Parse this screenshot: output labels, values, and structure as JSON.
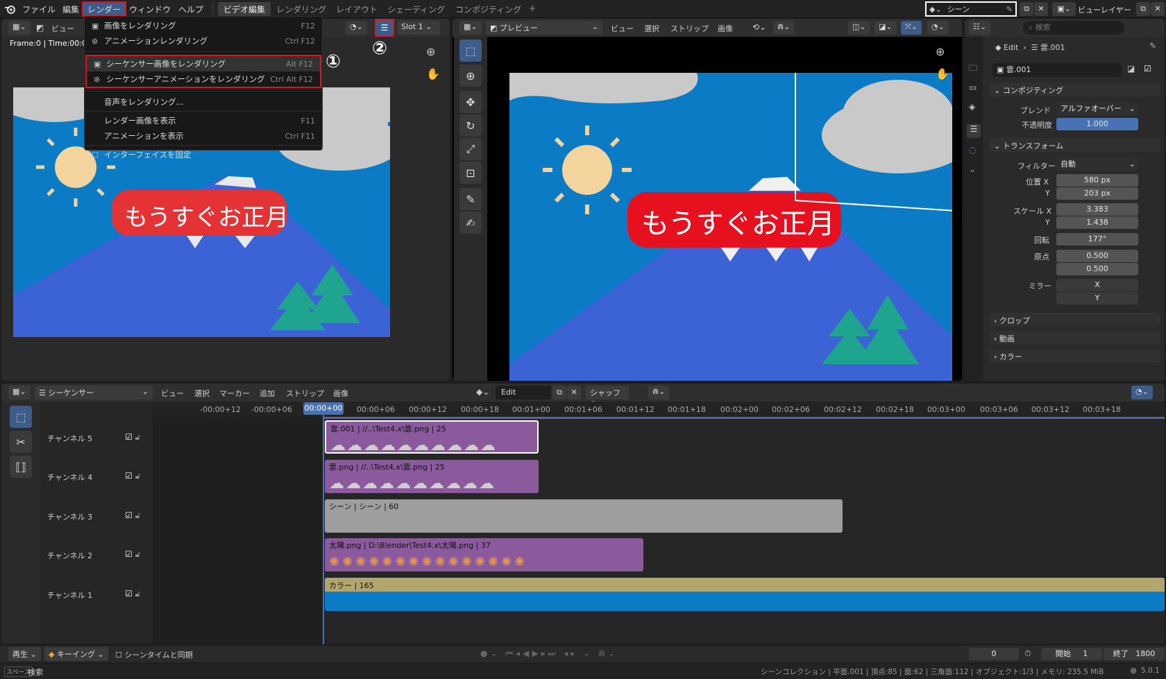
{
  "topbar": {
    "menus": [
      "ファイル",
      "編集",
      "レンダー",
      "ウィンドウ",
      "ヘルプ"
    ],
    "workspaces": [
      "ビデオ編集",
      "レンダリング",
      "レイアウト",
      "シェーディング",
      "コンポジティング",
      "+"
    ],
    "scene": "シーン",
    "view_layer": "ビューレイヤー"
  },
  "render_menu": {
    "items": [
      {
        "label": "画像をレンダリング",
        "shortcut": "F12",
        "icon": "camera-icon"
      },
      {
        "label": "アニメーションレンダリング",
        "shortcut": "Ctrl F12",
        "icon": "film-icon"
      },
      {
        "label": "シーケンサー画像をレンダリング",
        "shortcut": "Alt F12",
        "icon": "camera-icon"
      },
      {
        "label": "シーケンサーアニメーションをレンダリング",
        "shortcut": "Ctrl Alt F12",
        "icon": "film-icon"
      },
      {
        "label": "音声をレンダリング...",
        "shortcut": "",
        "icon": ""
      },
      {
        "label": "レンダー画像を表示",
        "shortcut": "F11",
        "icon": ""
      },
      {
        "label": "アニメーションを表示",
        "shortcut": "Ctrl F11",
        "icon": ""
      },
      {
        "label": "インターフェイスを固定",
        "shortcut": "",
        "icon": "checkbox-icon"
      }
    ],
    "annotation1": "①",
    "annotation2": "②"
  },
  "left_editor": {
    "view": "ビュー",
    "slot": "Slot 1",
    "frame_info": "Frame:0 | Time:00:0"
  },
  "preview_editor": {
    "mode": "プレビュー",
    "menus": [
      "ビュー",
      "選択",
      "ストリップ",
      "画像"
    ]
  },
  "image_text": "もうすぐお正月",
  "properties": {
    "search_placeholder": "検索",
    "breadcrumb_a": "Edit",
    "breadcrumb_b": "雲.001",
    "strip_name": "雲.001",
    "sections": {
      "compositing": "コンポジティング",
      "transform": "トランスフォーム",
      "crop": "クロップ",
      "video": "動画",
      "color": "カラー"
    },
    "blend_label": "ブレンド",
    "blend_value": "アルファオーバー",
    "opacity_label": "不透明度",
    "opacity_value": "1.000",
    "filter_label": "フィルター",
    "filter_value": "自動",
    "pos_x_label": "位置 X",
    "pos_x": "580 px",
    "y_label": "Y",
    "pos_y": "203 px",
    "scale_x_label": "スケール X",
    "scale_x": "3.383",
    "scale_y": "1.438",
    "rotation_label": "回転",
    "rotation": "177°",
    "origin_label": "原点",
    "origin_x": "0.500",
    "origin_y": "0.500",
    "mirror_label": "ミラー",
    "mirror_x": "X",
    "mirror_y": "Y"
  },
  "sequencer": {
    "editor_name": "シーケンサー",
    "menus": [
      "ビュー",
      "選択",
      "マーカー",
      "追加",
      "ストリップ",
      "画像"
    ],
    "edit_label": "Edit",
    "shuffle": "シャッフル",
    "times": [
      "-00:00+12",
      "-00:00+06",
      "00:00+00",
      "00:00+06",
      "00:00+12",
      "00:00+18",
      "00:01+00",
      "00:01+06",
      "00:01+12",
      "00:01+18",
      "00:02+00",
      "00:02+06",
      "00:02+12",
      "00:02+18",
      "00:03+00",
      "00:03+06",
      "00:03+12",
      "00:03+18"
    ],
    "channels": [
      "チャンネル 5",
      "チャンネル 4",
      "チャンネル 3",
      "チャンネル 2",
      "チャンネル 1"
    ],
    "strips": [
      {
        "label": "雲.001 | //..\\Test4.x\\雲.png | 25",
        "color": "#8b5a9c"
      },
      {
        "label": "雲.png | //..\\Test4.x\\雲.png | 25",
        "color": "#8b5a9c"
      },
      {
        "label": "シーン | シーン | 60",
        "color": "#9e9e9e"
      },
      {
        "label": "太陽.png | D:\\Blender\\Test4.x\\太陽.png | 37",
        "color": "#8b5a9c"
      },
      {
        "label": "カラー | 165",
        "color": "#b3a66a"
      }
    ]
  },
  "playback": {
    "play": "再生",
    "keying": "キーイング",
    "sync": "シーンタイムと同期",
    "frame": "0",
    "start_label": "開始",
    "start": "1",
    "end_label": "終了",
    "end": "1800"
  },
  "status": {
    "key": "スペース",
    "search": "検索",
    "info": "シーンコレクション | 平面.001 | 頂点:85 | 面:62 | 三角面:112 | オブジェクト:1/3 | メモリ: 235.5 MiB",
    "version": "5.0.1"
  }
}
